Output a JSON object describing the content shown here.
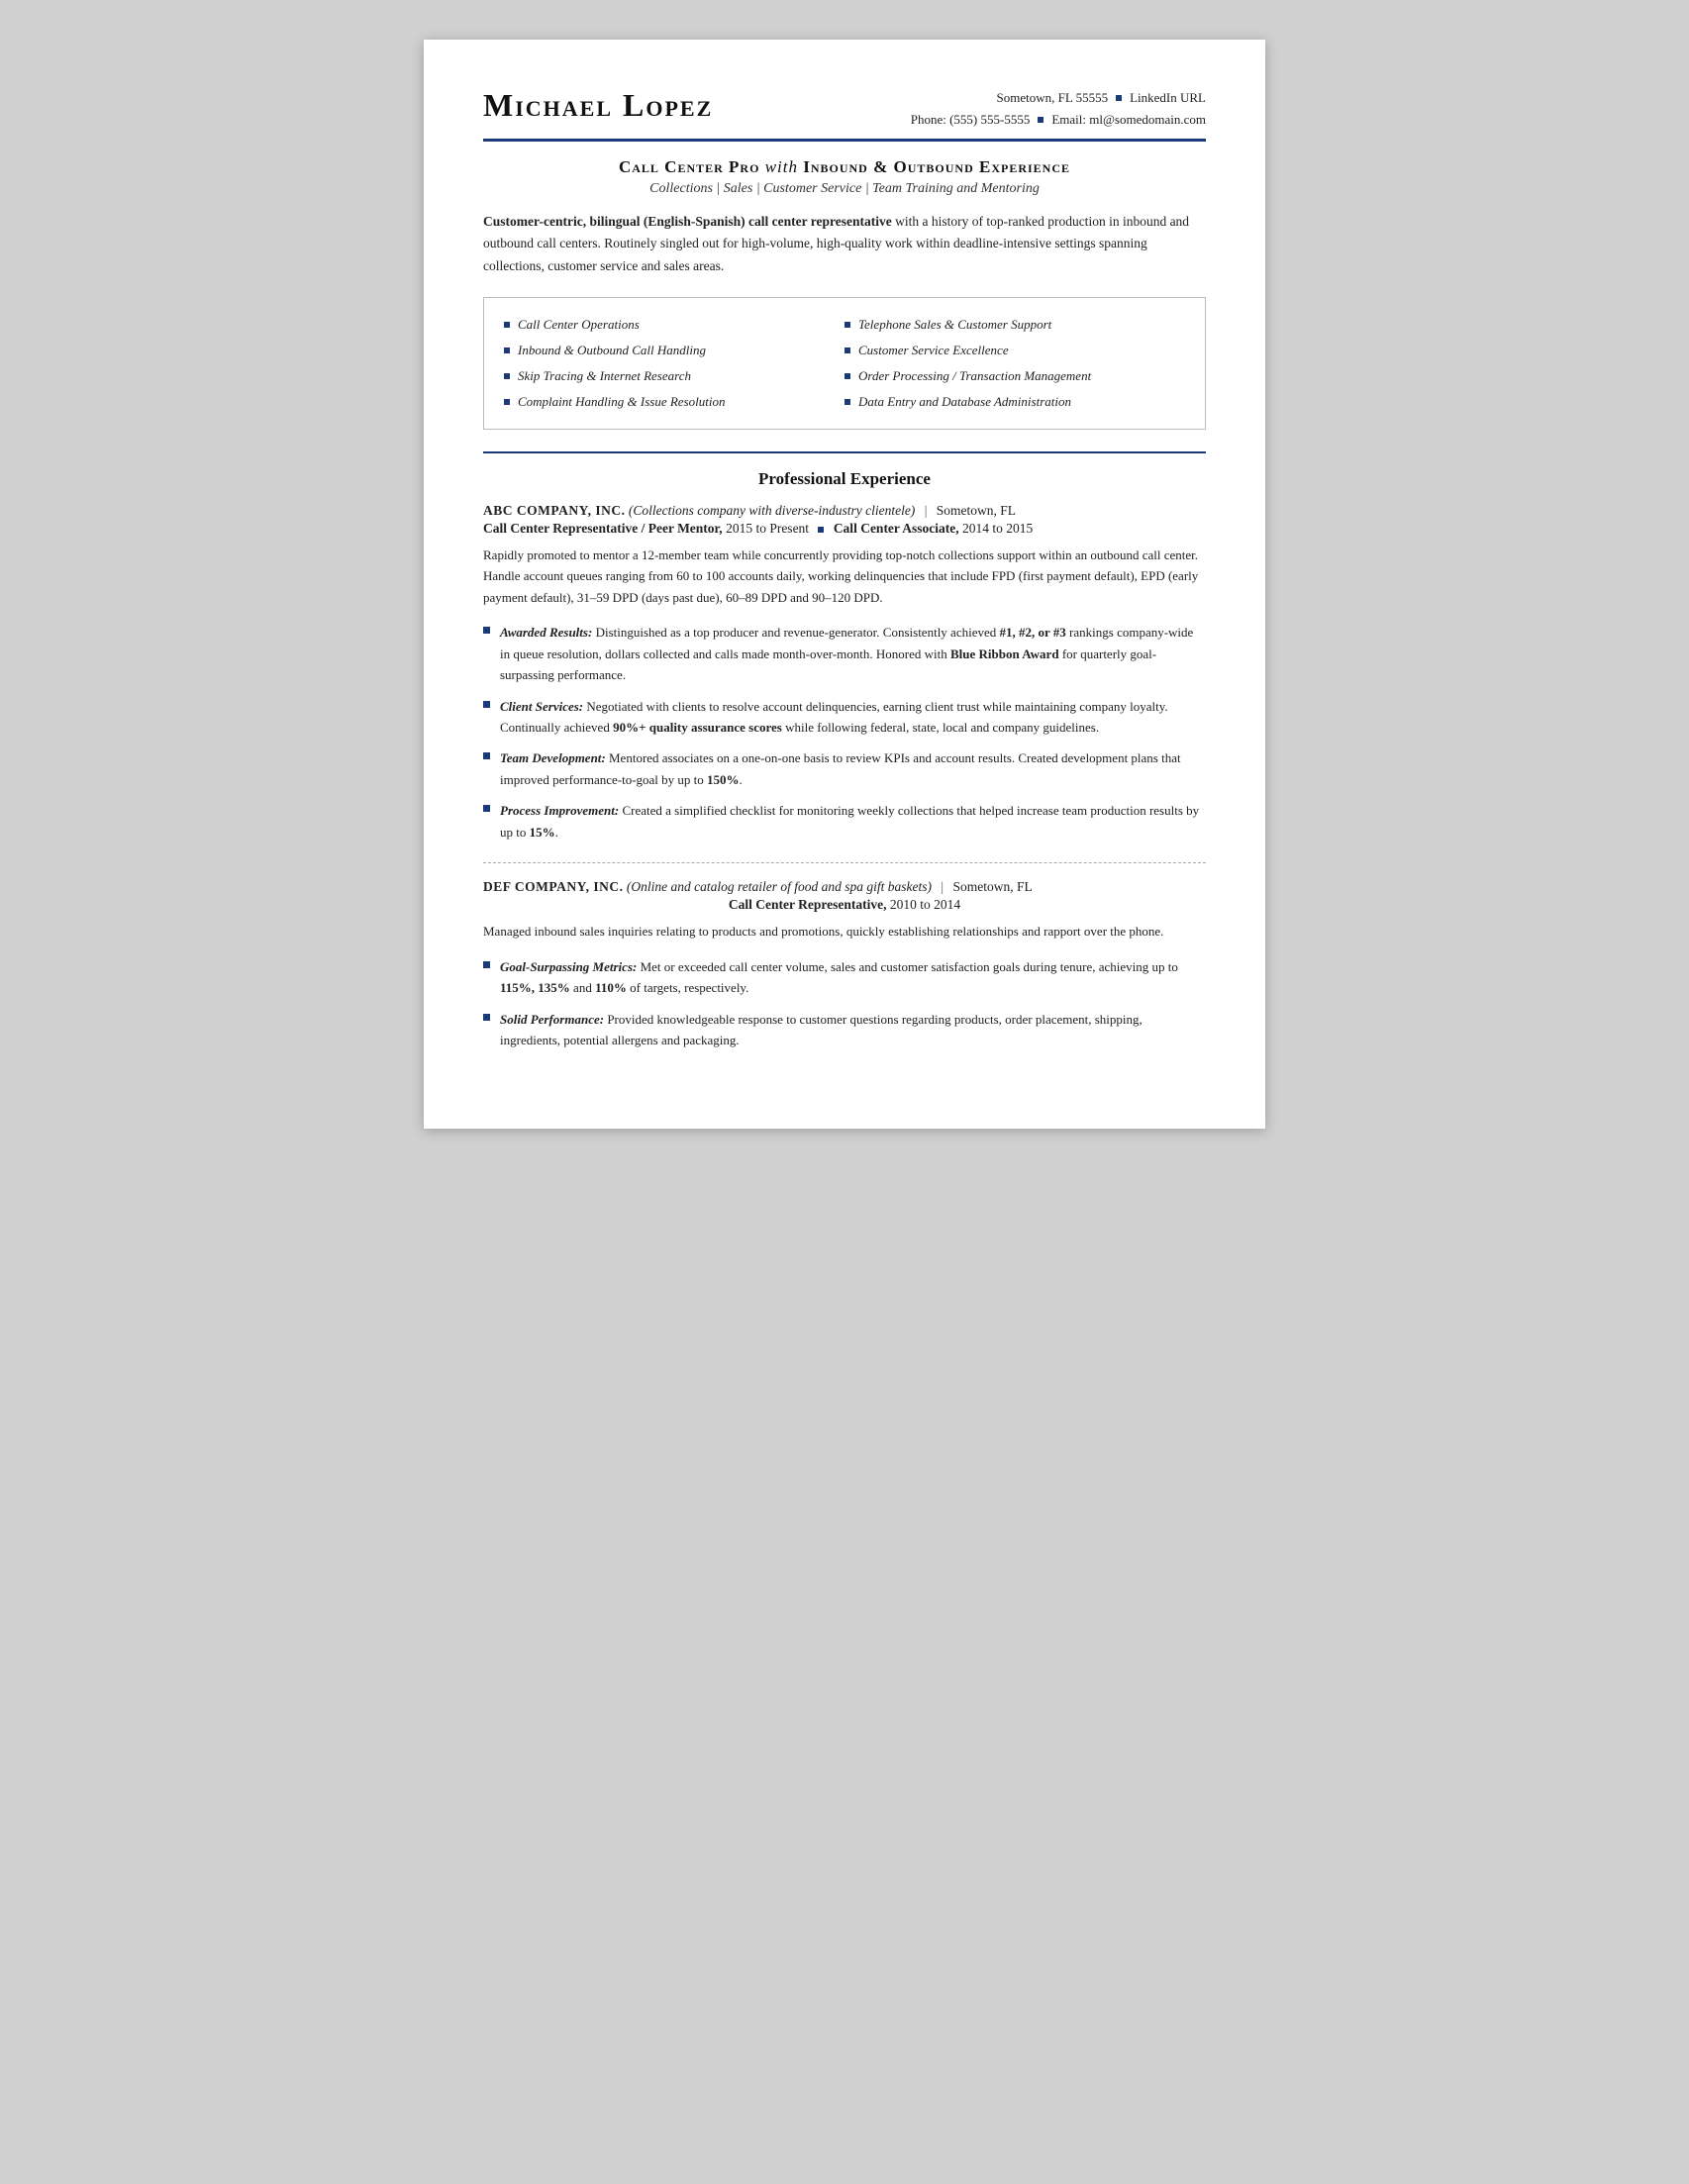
{
  "header": {
    "name": "Michael Lopez",
    "contact_line1_city": "Sometown, FL 55555",
    "contact_line1_linkedin": "LinkedIn URL",
    "contact_line2_phone": "Phone: (555) 555-5555",
    "contact_line2_email": "Email: ml@somedomain.com"
  },
  "title": {
    "main": "Call Center Pro",
    "italic_with": "with",
    "main2": "Inbound & Outbound Experience",
    "subtitle": "Collections | Sales | Customer Service | Team Training and Mentoring"
  },
  "summary": {
    "bold_part": "Customer-centric, bilingual (English-Spanish) call center representative",
    "rest": " with a history of top-ranked production in inbound and outbound call centers. Routinely singled out for high-volume, high-quality work within deadline-intensive settings spanning collections, customer service and sales areas."
  },
  "skills": {
    "col1": [
      "Call Center Operations",
      "Inbound & Outbound Call Handling",
      "Skip Tracing & Internet Research",
      "Complaint Handling & Issue Resolution"
    ],
    "col2": [
      "Telephone Sales & Customer Support",
      "Customer Service Excellence",
      "Order Processing / Transaction Management",
      "Data Entry and Database Administration"
    ]
  },
  "experience_section_title": "Professional Experience",
  "companies": [
    {
      "name": "ABC COMPANY, INC.",
      "description": "(Collections company with diverse-industry clientele)",
      "location": "Sometown, FL",
      "roles": [
        {
          "title1": "Call Center Representative / Peer Mentor,",
          "years1": "2015 to Present",
          "title2": "Call Center Associate,",
          "years2": "2014 to 2015"
        }
      ],
      "job_desc": "Rapidly promoted to mentor a 12-member team while concurrently providing top-notch collections support within an outbound call center. Handle account queues ranging from 60 to 100 accounts daily, working delinquencies that include FPD (first payment default), EPD (early payment default), 31–59 DPD (days past due), 60–89 DPD and 90–120 DPD.",
      "achievements": [
        {
          "bold_italic": "Awarded Results:",
          "text": " Distinguished as a top producer and revenue-generator. Consistently achieved ",
          "bold2": "#1, #2, or #3",
          "text2": " rankings company-wide in queue resolution, dollars collected and calls made month-over-month. Honored with ",
          "bold3": "Blue Ribbon Award",
          "text3": " for quarterly goal-surpassing performance."
        },
        {
          "bold_italic": "Client Services:",
          "text": " Negotiated with clients to resolve account delinquencies, earning client trust while maintaining company loyalty. Continually achieved ",
          "bold2": "90%+ quality assurance scores",
          "text2": " while following federal, state, local and company guidelines.",
          "text3": ""
        },
        {
          "bold_italic": "Team Development:",
          "text": " Mentored associates on a one-on-one basis to review KPIs and account results. Created development plans that improved performance-to-goal by up to ",
          "bold2": "150%",
          "text2": ".",
          "text3": ""
        },
        {
          "bold_italic": "Process Improvement:",
          "text": " Created a simplified checklist for monitoring weekly collections that helped increase team production results by up to ",
          "bold2": "15%",
          "text2": ".",
          "text3": ""
        }
      ]
    },
    {
      "name": "DEF COMPANY, INC.",
      "description": "(Online and catalog retailer of food and spa gift baskets)",
      "location": "Sometown, FL",
      "roles": [
        {
          "title1": "Call Center Representative,",
          "years1": "2010 to 2014",
          "title2": "",
          "years2": ""
        }
      ],
      "job_desc": "Managed inbound sales inquiries relating to products and promotions, quickly establishing relationships and rapport over the phone.",
      "achievements": [
        {
          "bold_italic": "Goal-Surpassing Metrics:",
          "text": " Met or exceeded call center volume, sales and customer satisfaction goals during tenure, achieving up to ",
          "bold2": "115%, 135%",
          "text2": " and ",
          "bold3": "110%",
          "text3": " of targets, respectively."
        },
        {
          "bold_italic": "Solid Performance:",
          "text": " Provided knowledgeable response to customer questions regarding products, order placement, shipping, ingredients, potential allergens and packaging.",
          "bold2": "",
          "text2": "",
          "text3": ""
        }
      ]
    }
  ]
}
